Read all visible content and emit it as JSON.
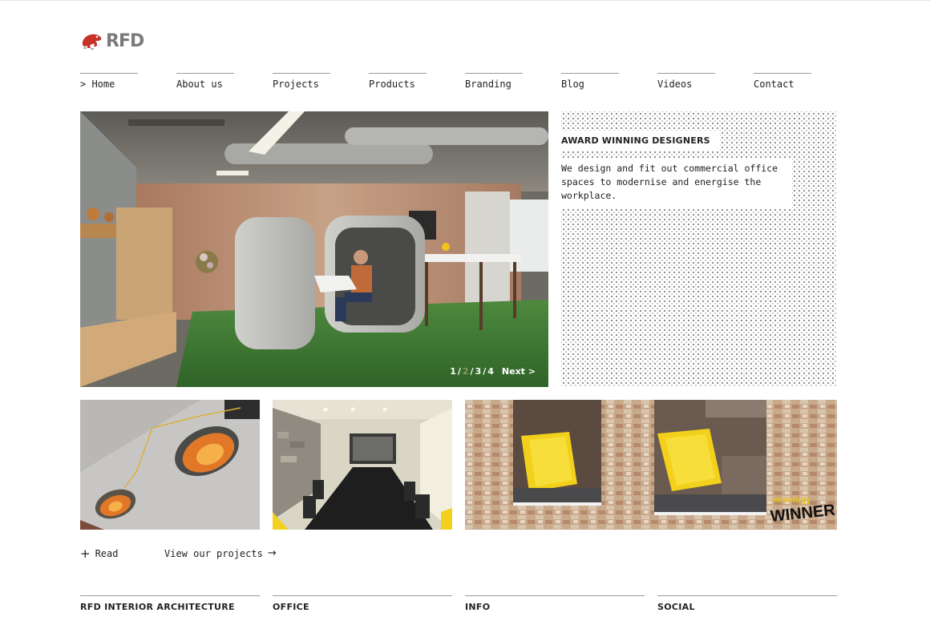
{
  "brand": {
    "name": "RFD",
    "logo_icon": "frog-icon",
    "logo_color": "#c8302a"
  },
  "nav": {
    "items": [
      {
        "label": "> Home"
      },
      {
        "label": "About us"
      },
      {
        "label": "Projects"
      },
      {
        "label": "Products"
      },
      {
        "label": "Branding"
      },
      {
        "label": "Blog"
      },
      {
        "label": "Videos"
      },
      {
        "label": "Contact"
      }
    ]
  },
  "hero": {
    "pager": {
      "pages": [
        "1",
        "2",
        "3",
        "4"
      ],
      "separator": "/",
      "active_page": "2",
      "next_label": "Next >"
    }
  },
  "intro": {
    "title": "AWARD WINNING DESIGNERS",
    "body": "We design and fit out commercial office spaces to modernise and energise the workplace."
  },
  "thumbnails": {
    "award_badge_top": "mixology",
    "award_badge_bottom": "WINNER"
  },
  "links": {
    "read_label": "Read",
    "read_icon": "plus-icon",
    "projects_label": "View our projects",
    "projects_icon": "arrow-right-icon"
  },
  "footer": {
    "columns": [
      {
        "title": "RFD INTERIOR ARCHITECTURE"
      },
      {
        "title": "OFFICE"
      },
      {
        "title": "INFO"
      },
      {
        "title": "SOCIAL"
      }
    ]
  },
  "colors": {
    "accent_yellow": "#f2d01c",
    "carpet_green": "#3f7a34",
    "divider_grey": "#9a9a9a"
  }
}
